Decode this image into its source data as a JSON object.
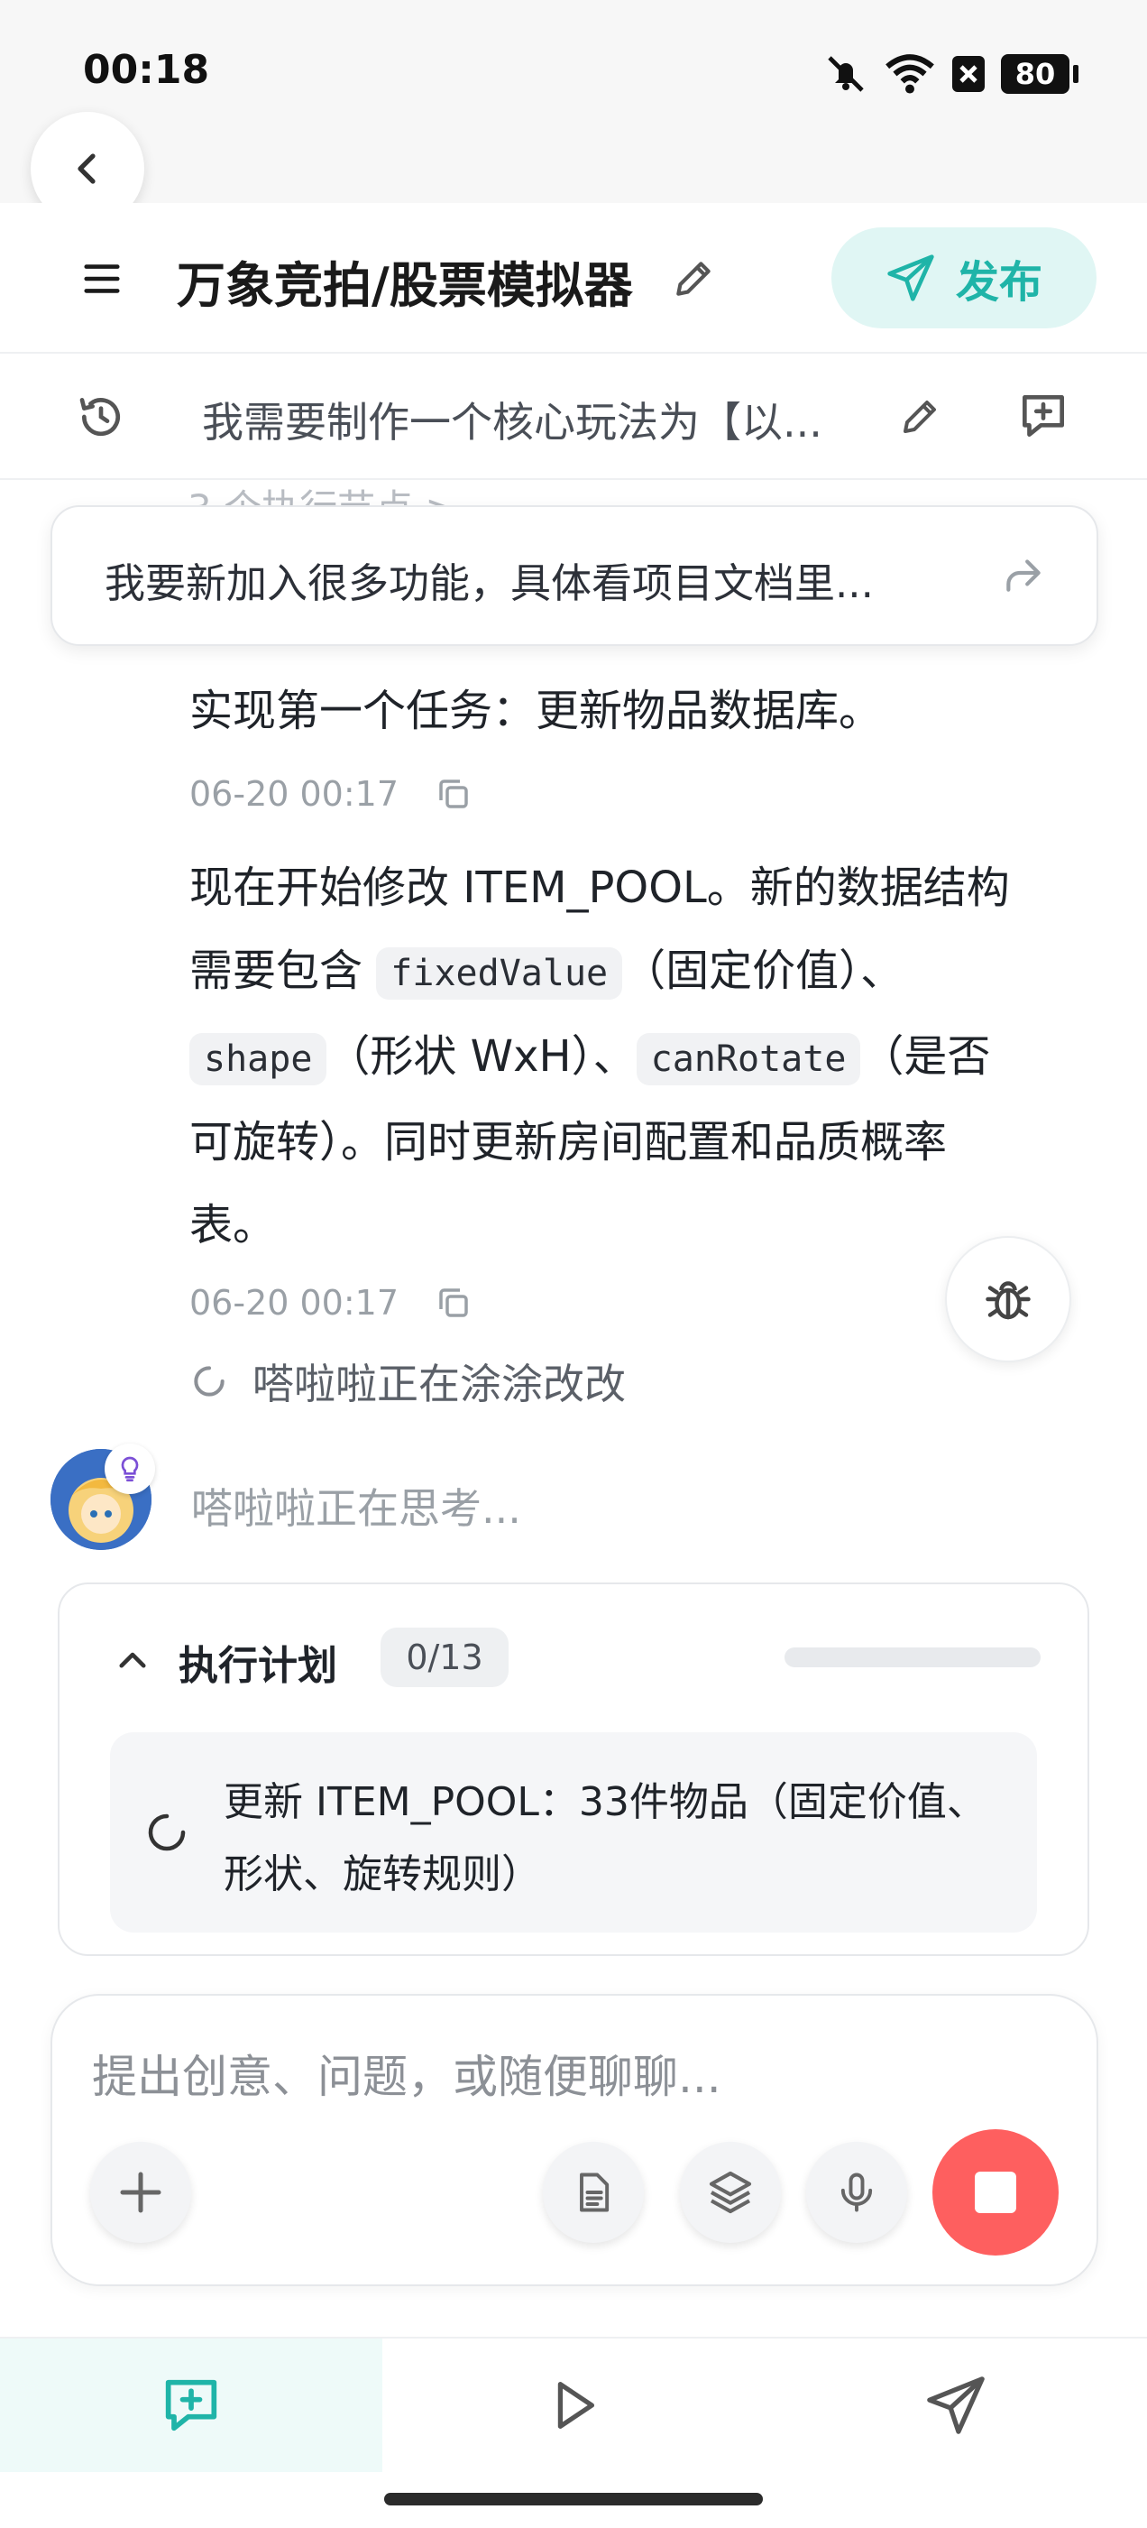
{
  "status_bar": {
    "time": "00:18",
    "battery": "80"
  },
  "header": {
    "title": "万象竞拍/股票模拟器",
    "publish_label": "发布"
  },
  "subbar": {
    "text": "我需要制作一个核心玩法为【以..."
  },
  "faded_text": "3 个执行节点 >",
  "pinned_message": {
    "text": "我要新加入很多功能，具体看项目文档里..."
  },
  "messages": [
    {
      "text": "实现第一个任务：更新物品数据库。",
      "timestamp": "06-20 00:17"
    },
    {
      "parts": {
        "p1": "现在开始修改 ITEM_POOL。新的数据结构",
        "p2": "需要包含",
        "code1": "fixedValue",
        "p3": "（固定价值）、",
        "code2": "shape",
        "p4": "（形状 WxH）、",
        "code3": "canRotate",
        "p5": "（是否",
        "p6": "可旋转）。同时更新房间配置和品质概率",
        "p7": "表。"
      },
      "timestamp": "06-20 00:17"
    }
  ],
  "working_status": "嗒啦啦正在涂涂改改",
  "thinking_status": "嗒啦啦正在思考...",
  "plan": {
    "title": "执行计划",
    "count": "0/13",
    "progress": 0,
    "items": [
      {
        "text": "更新 ITEM_POOL：33件物品（固定价值、形状、旋转规则）",
        "status": "in-progress"
      }
    ]
  },
  "composer": {
    "placeholder": "提出创意、问题，或随便聊聊..."
  },
  "colors": {
    "accent": "#1fb4a8",
    "stop": "#fe5f5f",
    "publish_bg": "#e0f6f4"
  },
  "tabs": [
    {
      "icon": "chat-plus-icon",
      "active": true
    },
    {
      "icon": "play-icon",
      "active": false
    },
    {
      "icon": "send-icon",
      "active": false
    }
  ]
}
